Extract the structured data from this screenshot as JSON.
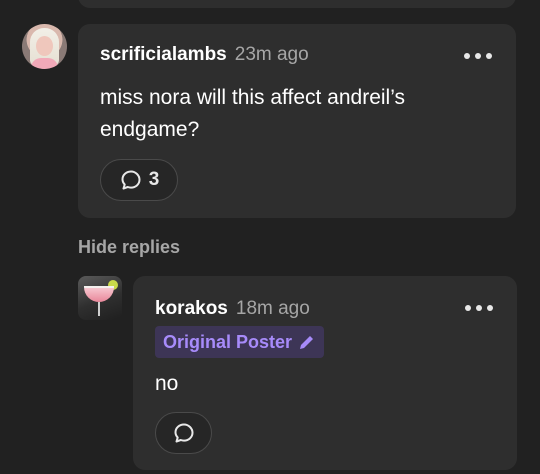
{
  "comment": {
    "username": "scrificialambs",
    "timestamp": "23m ago",
    "text": "miss nora will this affect andreil’s endgame?",
    "reply_count": "3"
  },
  "hide_replies_label": "Hide replies",
  "reply": {
    "username": "korakos",
    "timestamp": "18m ago",
    "badge_label": "Original Poster",
    "text": "no"
  },
  "colors": {
    "background": "#212121",
    "card": "#2e2e2e",
    "badge_bg": "#3d3556",
    "badge_text": "#a78bfa",
    "muted_text": "#a6a6a6"
  },
  "icons": {
    "more": "more-horizontal-icon",
    "reply": "speech-bubble-icon",
    "badge": "pencil-icon"
  }
}
